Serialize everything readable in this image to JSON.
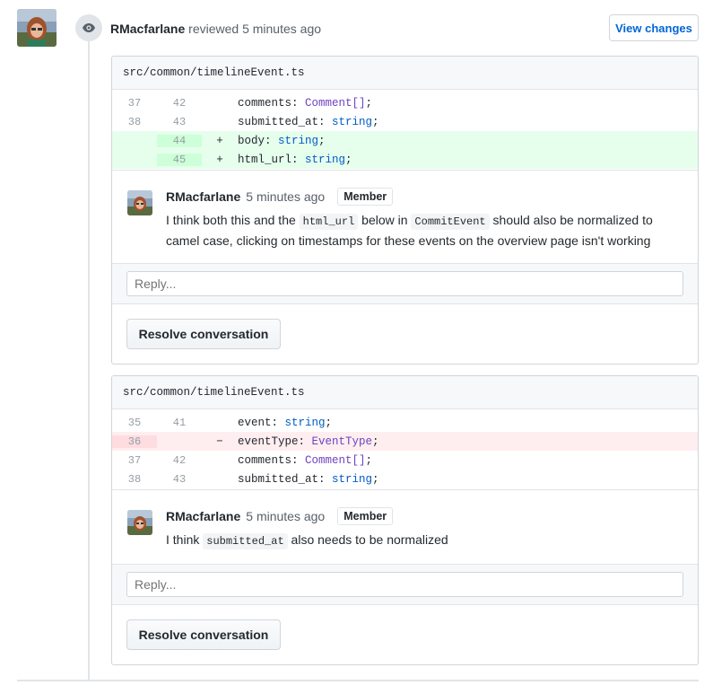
{
  "review": {
    "author": "RMacfarlane",
    "action": "reviewed 5 minutes ago",
    "view_changes_label": "View changes"
  },
  "threads": [
    {
      "file": "src/common/timelineEvent.ts",
      "lines": [
        {
          "old": "37",
          "new": "42",
          "sign": "",
          "type": "ctx",
          "prop": "comments",
          "val": "Comment[]",
          "valclass": "type"
        },
        {
          "old": "38",
          "new": "43",
          "sign": "",
          "type": "ctx",
          "prop": "submitted_at",
          "val": "string",
          "valclass": "str"
        },
        {
          "old": "",
          "new": "44",
          "sign": "+",
          "type": "add",
          "prop": "body",
          "val": "string",
          "valclass": "str"
        },
        {
          "old": "",
          "new": "45",
          "sign": "+",
          "type": "add",
          "prop": "html_url",
          "val": "string",
          "valclass": "str"
        }
      ],
      "comment": {
        "author": "RMacfarlane",
        "time": "5 minutes ago",
        "badge": "Member",
        "body_parts": [
          "I think both this and the ",
          "html_url",
          " below in ",
          "CommitEvent",
          " should also be normalized to camel case, clicking on timestamps for these events on the overview page isn't working"
        ]
      },
      "reply_placeholder": "Reply...",
      "resolve_label": "Resolve conversation"
    },
    {
      "file": "src/common/timelineEvent.ts",
      "lines": [
        {
          "old": "35",
          "new": "41",
          "sign": "",
          "type": "ctx",
          "prop": "event",
          "val": "string",
          "valclass": "str"
        },
        {
          "old": "36",
          "new": "",
          "sign": "−",
          "type": "del",
          "prop": "eventType",
          "val": "EventType",
          "valclass": "type"
        },
        {
          "old": "37",
          "new": "42",
          "sign": "",
          "type": "ctx",
          "prop": "comments",
          "val": "Comment[]",
          "valclass": "type"
        },
        {
          "old": "38",
          "new": "43",
          "sign": "",
          "type": "ctx",
          "prop": "submitted_at",
          "val": "string",
          "valclass": "str"
        }
      ],
      "comment": {
        "author": "RMacfarlane",
        "time": "5 minutes ago",
        "badge": "Member",
        "body_parts": [
          "I think ",
          "submitted_at",
          " also needs to be normalized"
        ]
      },
      "reply_placeholder": "Reply...",
      "resolve_label": "Resolve conversation"
    }
  ],
  "colors": {
    "add_bg": "#e6ffed",
    "del_bg": "#ffeef0",
    "link": "#0366d6"
  }
}
